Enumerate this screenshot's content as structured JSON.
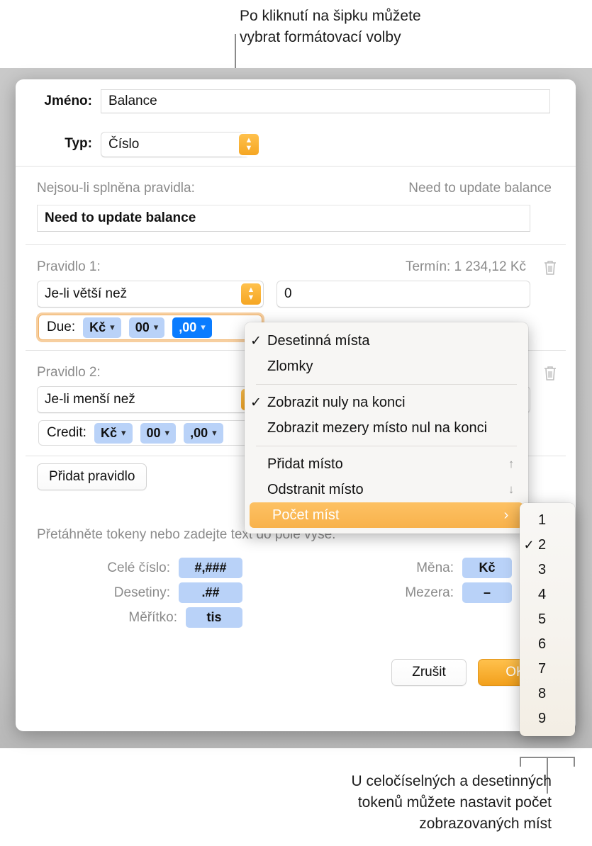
{
  "callouts": {
    "top": "Po kliknutí na šipku můžete\nvybrat formátovací volby",
    "bottom": "U celočíselných a desetinných\ntokenů můžete nastavit počet\nzobrazovaných míst"
  },
  "dialog": {
    "name_label": "Jméno:",
    "name_value": "Balance",
    "type_label": "Typ:",
    "type_value": "Číslo",
    "fallback_label": "Nejsou-li splněna pravidla:",
    "fallback_preview": "Need to update balance",
    "fallback_value": "Need to update balance",
    "rules": [
      {
        "label": "Pravidlo 1:",
        "preview": "Termín: 1 234,12 Kč",
        "condition": "Je-li větší než",
        "value": "0",
        "token_name": "Due:",
        "tokens": [
          {
            "text": "Kč",
            "selected": false,
            "caret": true
          },
          {
            "text": "00",
            "selected": false,
            "caret": true
          },
          {
            "text": ",00",
            "selected": true,
            "caret": true
          }
        ]
      },
      {
        "label": "Pravidlo 2:",
        "preview": "",
        "condition": "Je-li menší než",
        "value": "",
        "token_name": "Credit:",
        "tokens": [
          {
            "text": "Kč",
            "selected": false,
            "caret": true
          },
          {
            "text": "00",
            "selected": false,
            "caret": true
          },
          {
            "text": ",00",
            "selected": false,
            "caret": true
          }
        ]
      }
    ],
    "add_rule_label": "Přidat pravidlo",
    "hint": "Přetáhněte tokeny nebo zadejte text do pole výše.",
    "token_palette_left": [
      {
        "label": "Celé číslo:",
        "token": "#,###"
      },
      {
        "label": "Desetiny:",
        "token": ".##"
      },
      {
        "label": "Měřítko:",
        "token": "tis"
      }
    ],
    "token_palette_right": [
      {
        "label": "Měna:",
        "token": "Kč"
      },
      {
        "label": "Mezera:",
        "token": "–"
      }
    ],
    "cancel_label": "Zrušit",
    "ok_label": "OK"
  },
  "menu": {
    "items": [
      {
        "label": "Desetinná místa",
        "checked": true,
        "trailing": "",
        "highlight": false
      },
      {
        "label": "Zlomky",
        "checked": false,
        "trailing": "",
        "highlight": false
      },
      {
        "separator": true
      },
      {
        "label": "Zobrazit nuly na konci",
        "checked": true,
        "trailing": "",
        "highlight": false
      },
      {
        "label": "Zobrazit mezery místo nul na konci",
        "checked": false,
        "trailing": "",
        "highlight": false
      },
      {
        "separator": true
      },
      {
        "label": "Přidat místo",
        "checked": false,
        "trailing": "↑",
        "highlight": false
      },
      {
        "label": "Odstranit místo",
        "checked": false,
        "trailing": "↓",
        "highlight": false
      },
      {
        "label": "Počet míst",
        "checked": false,
        "trailing": "›",
        "highlight": true
      }
    ]
  },
  "submenu": {
    "options": [
      {
        "value": "1",
        "checked": false
      },
      {
        "value": "2",
        "checked": true
      },
      {
        "value": "3",
        "checked": false
      },
      {
        "value": "4",
        "checked": false
      },
      {
        "value": "5",
        "checked": false
      },
      {
        "value": "6",
        "checked": false
      },
      {
        "value": "7",
        "checked": false
      },
      {
        "value": "8",
        "checked": false
      },
      {
        "value": "9",
        "checked": false
      }
    ]
  },
  "colors": {
    "accent_orange": "#f5a623",
    "token_blue": "#b9d2f8",
    "token_selected": "#0a7cff",
    "highlight_orange": "#f8b24c"
  },
  "icons": {
    "stepper": "stepper-icon",
    "trash": "trash-icon",
    "checkmark": "check-icon",
    "chevron_right": "chevron-right-icon",
    "chevron_down": "chevron-down-icon"
  }
}
